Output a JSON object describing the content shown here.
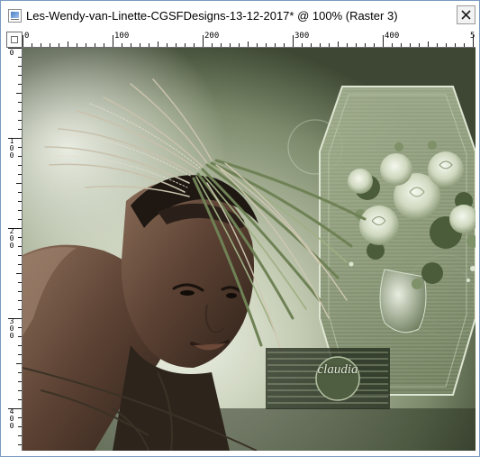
{
  "window": {
    "title": "Les-Wendy-van-Linette-CGSFDesigns-13-12-2017* @ 100% (Raster 3)",
    "app_icon": "image-document-icon",
    "close_icon": "close-icon"
  },
  "ruler": {
    "units": "pixels",
    "horizontal_labels": [
      "0",
      "100",
      "200",
      "300",
      "400",
      "5"
    ],
    "vertical_labels": [
      "0",
      "100",
      "200",
      "300",
      "400"
    ],
    "corner_icon": "ruler-origin-icon"
  },
  "canvas": {
    "layer": "Raster 3",
    "zoom": "100%",
    "watermark_text": "claudia",
    "palette": {
      "sage_light": "#e3e8d8",
      "sage_mid": "#8f9d7e",
      "sage_dark": "#3e4a33",
      "shadow": "#1c2216"
    }
  }
}
